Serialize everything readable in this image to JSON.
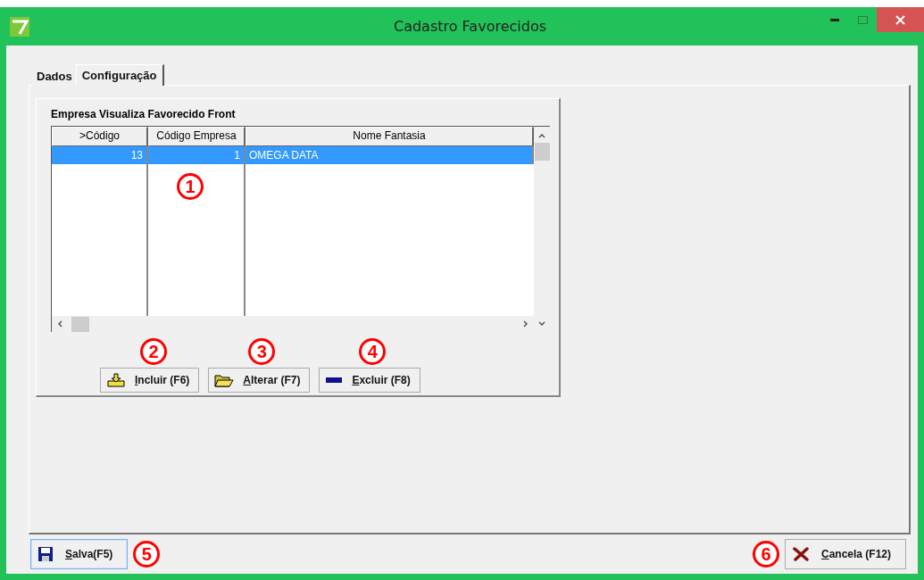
{
  "window": {
    "title": "Cadastro Favorecidos"
  },
  "tabs": [
    {
      "label": "Dados",
      "selected": false
    },
    {
      "label": "Configuração",
      "selected": true
    }
  ],
  "group": {
    "title": "Empresa Visualiza Favorecido Front"
  },
  "table": {
    "columns": [
      ">Código",
      "Código Empresa",
      "Nome Fantasia"
    ],
    "rows": [
      {
        "cells": [
          "13",
          "1",
          "OMEGA DATA"
        ],
        "selected": true
      }
    ]
  },
  "grid_buttons": [
    {
      "label": "Incluir (F6)",
      "kind": "add"
    },
    {
      "label": "Alterar (F7)",
      "kind": "edit"
    },
    {
      "label": "Excluir (F8)",
      "kind": "delete"
    }
  ],
  "footer_buttons": [
    {
      "label": "Salva(F5)",
      "kind": "save",
      "focused": true
    },
    {
      "label": "Cancela (F12)",
      "kind": "cancel",
      "focused": false
    }
  ],
  "annotations": [
    {
      "label": "1"
    },
    {
      "label": "2"
    },
    {
      "label": "3"
    },
    {
      "label": "4"
    },
    {
      "label": "5"
    },
    {
      "label": "6"
    }
  ]
}
